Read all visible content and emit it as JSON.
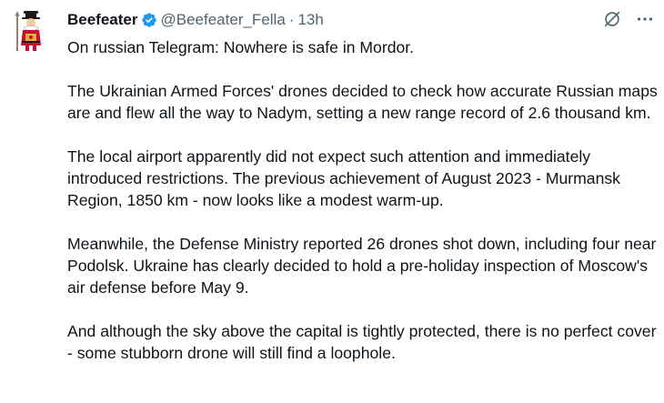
{
  "author": {
    "display_name": "Beefeater",
    "handle": "@Beefeater_Fella",
    "separator": "·",
    "time": "13h"
  },
  "icons": {
    "verified": "verified-badge-icon",
    "grok": "grok-icon",
    "more": "more-options-icon",
    "verified_color": "#1d9bf0"
  },
  "tweet": {
    "paragraphs": [
      "On russian Telegram: Nowhere is safe in Mordor.",
      "The Ukrainian Armed Forces' drones decided to check how accurate Russian maps are and flew all the way to Nadym, setting a new range record of 2.6 thousand km.",
      "The local airport apparently did not expect such attention and immediately introduced restrictions. The previous achievement of August 2023 - Murmansk Region, 1850 km - now looks like a modest warm-up.",
      "Meanwhile, the Defense Ministry reported 26 drones shot down, including four near Podolsk. Ukraine has clearly decided to hold a pre-holiday inspection of Moscow's air defense before May 9.",
      "And although the sky above the capital is tightly protected, there is no perfect cover - some stubborn drone will still find a loophole."
    ]
  }
}
